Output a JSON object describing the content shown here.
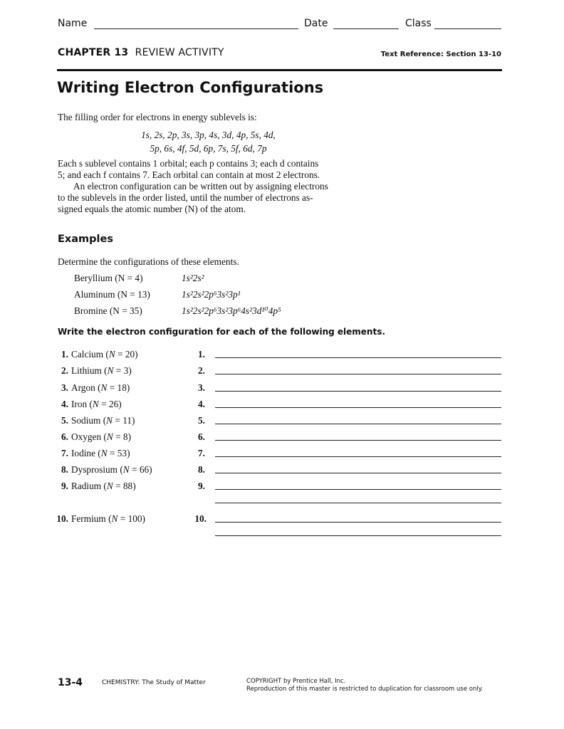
{
  "header": {
    "name_label": "Name",
    "date_label": "Date",
    "class_label": "Class",
    "chapter_prefix": "CHAPTER 13",
    "chapter_title": "REVIEW ACTIVITY",
    "text_reference": "Text Reference: Section 13-10"
  },
  "title": "Writing Electron Configurations",
  "intro": {
    "filling_order_lead": "The filling order for electrons in energy sublevels is:",
    "filling_order_line1": "1s, 2s, 2p, 3s, 3p, 4s, 3d, 4p, 5s, 4d,",
    "filling_order_line2": "5p, 6s, 4f, 5d, 6p, 7s, 5f, 6d, 7p",
    "orbital_rule_line1": "Each s sublevel contains 1 orbital; each p contains 3; each d contains",
    "orbital_rule_line2": "5; and each f contains 7. Each orbital can contain at most 2 electrons.",
    "config_para_line1": "An electron configuration can be written out by assigning electrons",
    "config_para_line2": "to the sublevels in the order listed, until the number of electrons as-",
    "config_para_line3": "signed equals the atomic number (N) of the atom."
  },
  "examples": {
    "heading": "Examples",
    "lead": "Determine the configurations of these elements.",
    "items": [
      {
        "element": "Beryllium (N = 4)",
        "configuration": "1s²2s²"
      },
      {
        "element": "Aluminum (N = 13)",
        "configuration": "1s²2s²2p⁶3s²3p¹"
      },
      {
        "element": "Bromine (N = 35)",
        "configuration": "1s²2s²2p⁶3s²3p⁶4s²3d¹⁰4p⁵"
      }
    ]
  },
  "exercise": {
    "instruction": "Write the electron configuration for each of the following elements.",
    "questions": [
      {
        "num": "1.",
        "element": "Calcium",
        "n": "20",
        "answer_label": "1."
      },
      {
        "num": "2.",
        "element": "Lithium",
        "n": "3",
        "answer_label": "2."
      },
      {
        "num": "3.",
        "element": "Argon",
        "n": "18",
        "answer_label": "3."
      },
      {
        "num": "4.",
        "element": "Iron",
        "n": "26",
        "answer_label": "4."
      },
      {
        "num": "5.",
        "element": "Sodium",
        "n": "11",
        "answer_label": "5."
      },
      {
        "num": "6.",
        "element": "Oxygen",
        "n": "8",
        "answer_label": "6."
      },
      {
        "num": "7.",
        "element": "Iodine",
        "n": "53",
        "answer_label": "7."
      },
      {
        "num": "8.",
        "element": "Dysprosium",
        "n": "66",
        "answer_label": "8."
      },
      {
        "num": "9.",
        "element": "Radium",
        "n": "88",
        "answer_label": "9."
      },
      {
        "num": "10.",
        "element": "Fermium",
        "n": "100",
        "answer_label": "10."
      }
    ]
  },
  "footer": {
    "page_number": "13-4",
    "book_title": "CHEMISTRY: The Study of Matter",
    "copyright_line1": "COPYRIGHT by Prentice Hall, Inc.",
    "copyright_line2": "Reproduction of this master is restricted to duplication for classroom use only."
  }
}
